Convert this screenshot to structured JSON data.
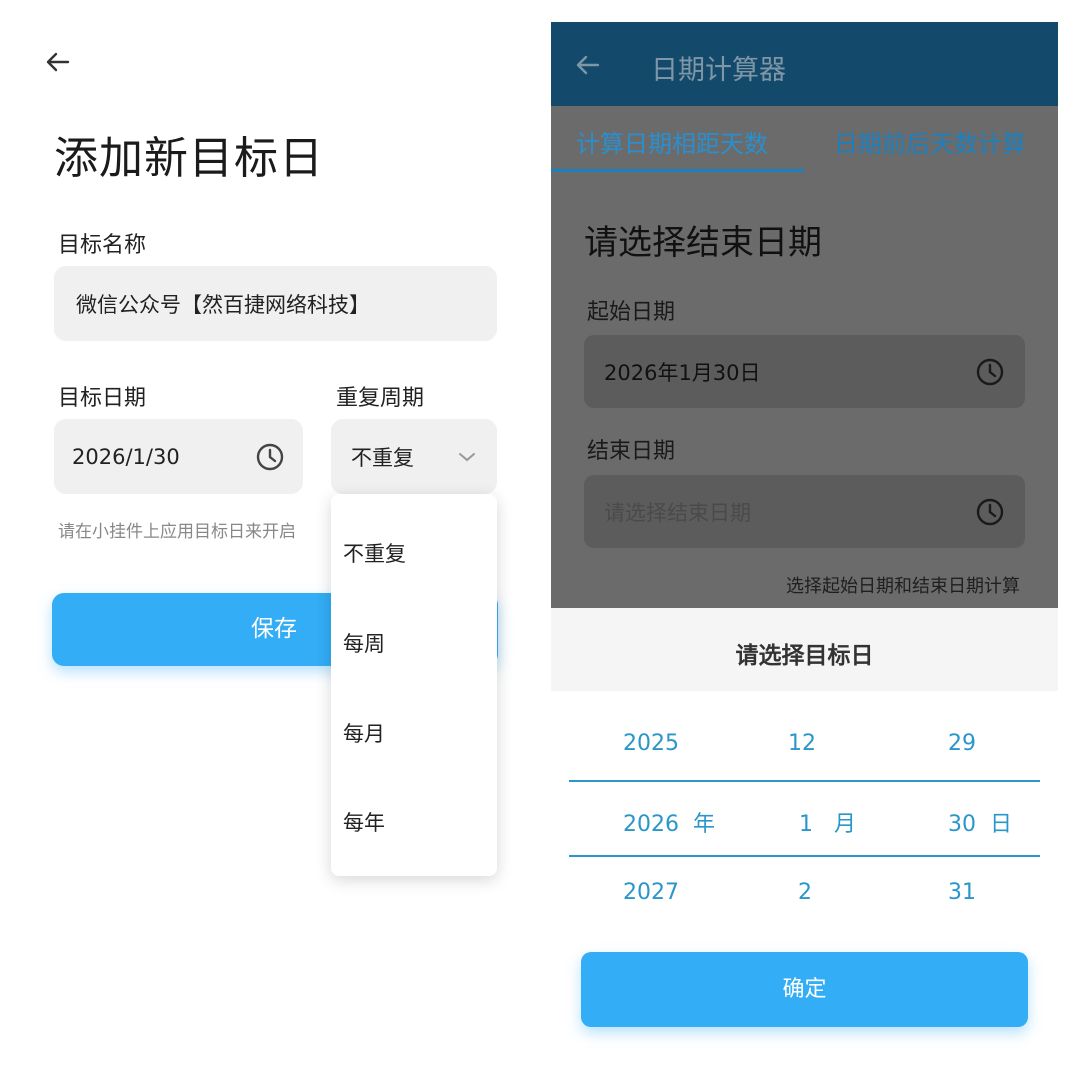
{
  "left": {
    "title": "添加新目标日",
    "name_label": "目标名称",
    "name_value": "微信公众号【然百捷网络科技】",
    "date_label": "目标日期",
    "date_value": "2026/1/30",
    "repeat_label": "重复周期",
    "repeat_value": "不重复",
    "hint": "请在小挂件上应用目标日来开启",
    "save_label": "保存",
    "dropdown_options": [
      "不重复",
      "每周",
      "每月",
      "每年"
    ]
  },
  "right": {
    "app_title": "日期计算器",
    "tabs": [
      "计算日期相距天数",
      "日期前后天数计算"
    ],
    "heading": "请选择结束日期",
    "start_label": "起始日期",
    "start_value": "2026年1月30日",
    "end_label": "结束日期",
    "end_placeholder": "请选择结束日期",
    "note": "选择起始日期和结束日期计算",
    "sheet_title": "请选择目标日",
    "picker": {
      "year": [
        "2025",
        "2026  年",
        "2027"
      ],
      "month": [
        "12",
        "1   月",
        "2"
      ],
      "day": [
        "29",
        "30  日",
        "31"
      ]
    },
    "confirm_label": "确定"
  },
  "colors": {
    "accent": "#33adf5",
    "appbar": "#134a6b",
    "picker_text": "#2a96c9",
    "overlay": "#6b6b6b"
  },
  "icons": [
    "back-arrow-icon",
    "clock-icon",
    "chevron-down-icon"
  ]
}
